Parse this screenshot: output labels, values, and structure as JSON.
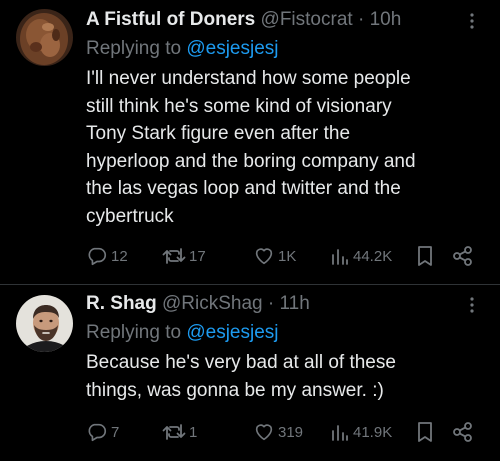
{
  "tweets": [
    {
      "display_name": "A Fistful of Doners",
      "handle": "@Fistocrat",
      "separator": "·",
      "time": "10h",
      "replying_prefix": "Replying to",
      "replying_to": "@esjesjesj",
      "text_lines": [
        "I'll never understand how some people",
        "still think he's some kind of visionary",
        "Tony Stark figure even after the",
        "hyperloop and the boring company and",
        "the las vegas loop and twitter and the",
        "cybertruck"
      ],
      "replies": "12",
      "retweets": "17",
      "likes": "1K",
      "views": "44.2K",
      "avatar_icon": "kebab-meat-photo-icon"
    },
    {
      "display_name": "R. Shag",
      "handle": "@RickShag",
      "separator": "·",
      "time": "11h",
      "replying_prefix": "Replying to",
      "replying_to": "@esjesjesj",
      "text_lines": [
        "Because he's very bad at all of these",
        "things, was gonna be my answer. :)"
      ],
      "replies": "7",
      "retweets": "1",
      "likes": "319",
      "views": "41.9K",
      "avatar_icon": "bearded-man-photo-icon"
    }
  ],
  "colors": {
    "background": "#000000",
    "text": "#e7e9ea",
    "muted": "#71767b",
    "link": "#1d9bf0",
    "divider": "#2f3336"
  }
}
